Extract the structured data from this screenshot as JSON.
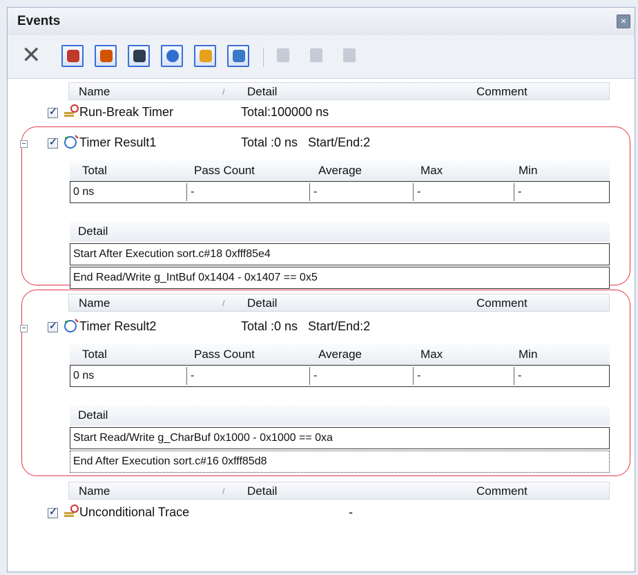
{
  "window": {
    "title": "Events",
    "close_glyph": "×"
  },
  "toolbar": {
    "delete_glyph": "✕",
    "buttons": [
      {
        "icon": "hardware-break-icon",
        "color": "#c0392b"
      },
      {
        "icon": "software-break-icon",
        "color": "#d35400"
      },
      {
        "icon": "trace-icon",
        "color": "#2c3e50"
      },
      {
        "icon": "timer-icon",
        "color": "#2f6fd0"
      },
      {
        "icon": "unconditional-trace-icon",
        "color": "#e6a11c"
      },
      {
        "icon": "other-event-icon",
        "color": "#3a79c6"
      }
    ],
    "disabled": [
      {
        "icon": "edit-condition-icon"
      },
      {
        "icon": "import-icon"
      },
      {
        "icon": "export-icon"
      }
    ]
  },
  "columns": {
    "name": "Name",
    "sort": "/",
    "detail": "Detail",
    "comment": "Comment"
  },
  "events": [
    {
      "name": "Run-Break Timer",
      "detail": "Total:100000 ns"
    },
    {
      "name": "Timer Result1",
      "detail": "Total :0 ns   Start/End:2"
    },
    {
      "name": "Timer Result2",
      "detail": "Total :0 ns   Start/End:2"
    },
    {
      "name": "Unconditional Trace",
      "detail": "-"
    }
  ],
  "result_table": {
    "headers": [
      "Total",
      "Pass Count",
      "Average",
      "Max",
      "Min"
    ],
    "detail_header": "Detail"
  },
  "timer_result1": {
    "values": [
      "0 ns",
      "-",
      "-",
      "-",
      "-"
    ],
    "details": [
      "Start After Execution sort.c#18 0xfff85e4",
      "End Read/Write g_IntBuf 0x1404 - 0x1407 == 0x5"
    ]
  },
  "timer_result2": {
    "values": [
      "0 ns",
      "-",
      "-",
      "-",
      "-"
    ],
    "details": [
      "Start Read/Write g_CharBuf 0x1000 - 0x1000 == 0xa",
      "End After Execution sort.c#16 0xfff85d8"
    ]
  },
  "colors": {
    "highlight": "#e5384a",
    "accent": "#3a6fd8"
  }
}
